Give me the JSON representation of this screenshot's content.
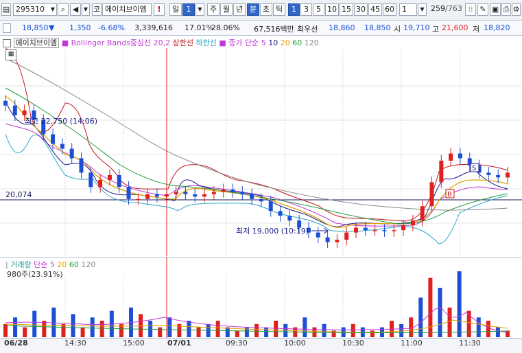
{
  "toolbar": {
    "code": "295310",
    "market_prefix": "코",
    "stock_name": "에이치브이엠",
    "alert": "!",
    "period_day": "일",
    "period_num": "1",
    "week": "주",
    "month": "월",
    "year": "년",
    "minute": "분",
    "second": "초",
    "tick": "틱",
    "intervals": [
      "1",
      "3",
      "5",
      "10",
      "15",
      "30",
      "45",
      "60"
    ],
    "interval_selected": "1",
    "count_value": "1",
    "page_current": "259",
    "page_total": "/763"
  },
  "quote": {
    "price": "18,850",
    "change_arrow": "▼",
    "change": "1,350",
    "change_pct": "-6.68%",
    "volume": "3,339,616",
    "turnover_pct": "17.01%",
    "ratio_pct": "28.06%",
    "amount": "67,516백만",
    "sell_label": "최우선",
    "sell_price": "18,860",
    "buy_price": "18,850",
    "open_label": "시",
    "open": "19,710",
    "high_label": "고",
    "high": "21,600",
    "low_label": "저",
    "low": "18,820"
  },
  "price_legend": {
    "name": "에이치브이엠",
    "bollinger": "Bollinger Bands중심선 20,2",
    "upper": "상한선",
    "lower": "하한선",
    "ma_label": "종가 단순 5",
    "ma10": "10",
    "ma20": "20",
    "ma60": "60",
    "ma120": "120"
  },
  "annotations": {
    "high_note": "최고 22,750 (14:06)",
    "low_note": "최저 19,000 (10:19)",
    "level_label": "20,074",
    "marker_b": "B",
    "marker_s": "S"
  },
  "volume_legend": {
    "title": "거래량",
    "ma_label": "단순 5",
    "ma20": "20",
    "ma60": "60",
    "ma120": "120",
    "unit_note": "980주(23.91%)"
  },
  "time_axis": [
    "06/28",
    "14:30",
    "15:00",
    "07/01",
    "09:30",
    "10:00",
    "10:30",
    "11:00",
    "11:30"
  ],
  "colors": {
    "up": "#e0201c",
    "down": "#1c4fd6",
    "bb_upper": "#c0141b",
    "bb_lower": "#2aa6c8",
    "bb_mid": "#c03ad6",
    "ma5": "#1a1a8c",
    "ma10": "#e0a000",
    "ma20": "#1f9a3c",
    "ma60": "#777777",
    "ma120": "#555555"
  },
  "chart_data": {
    "type": "candlestick",
    "price_range_visible": [
      18800,
      23100
    ],
    "level_line": 20074,
    "high": {
      "price": 22750,
      "time": "14:06"
    },
    "low": {
      "price": 19000,
      "time": "10:19"
    },
    "close_series": [
      21900,
      21700,
      21800,
      21600,
      21300,
      21100,
      21000,
      20800,
      20500,
      20200,
      20350,
      20450,
      20200,
      19950,
      19950,
      20050,
      20000,
      20050,
      20100,
      20050,
      20000,
      20050,
      20100,
      20150,
      20100,
      20050,
      19950,
      19900,
      19700,
      19600,
      19500,
      19350,
      19250,
      19150,
      19050,
      19100,
      19250,
      19350,
      19300,
      19300,
      19280,
      19300,
      19400,
      19500,
      19800,
      20300,
      20750,
      20900,
      20800,
      20650,
      20500,
      20450,
      20400,
      20500
    ],
    "volume_series": [
      4,
      6,
      3,
      8,
      5,
      9,
      4,
      7,
      3,
      6,
      5,
      8,
      4,
      9,
      7,
      5,
      3,
      6,
      4,
      5,
      3,
      4,
      5,
      3,
      2,
      3,
      4,
      3,
      5,
      4,
      3,
      6,
      3,
      4,
      2,
      3,
      4,
      3,
      2,
      3,
      5,
      4,
      6,
      12,
      18,
      15,
      9,
      20,
      8,
      6,
      5,
      3,
      2
    ]
  }
}
